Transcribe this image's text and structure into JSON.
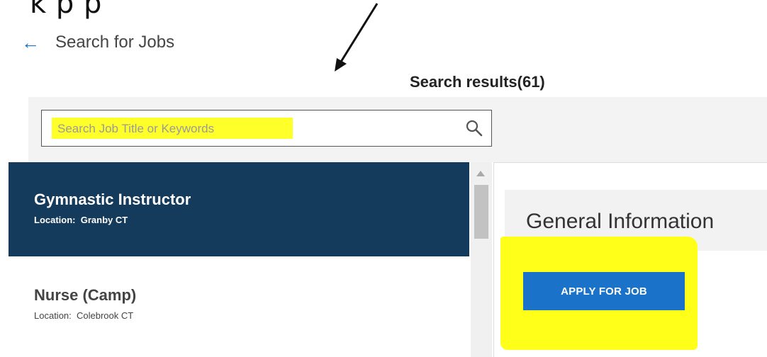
{
  "annotation": {
    "partial_text": "k   p   p"
  },
  "header": {
    "back_label": "Search for Jobs",
    "results_title": "Search results(61)"
  },
  "search": {
    "placeholder": "Search Job Title or Keywords",
    "value": ""
  },
  "jobs": [
    {
      "title": "Gymnastic Instructor",
      "location_label": "Location:",
      "location": "Granby CT",
      "selected": true
    },
    {
      "title": "Nurse (Camp)",
      "location_label": "Location:",
      "location": "Colebrook CT",
      "selected": false
    }
  ],
  "detail": {
    "section_title": "General Information",
    "apply_label": "APPLY FOR JOB"
  },
  "colors": {
    "accent": "#1a73c8",
    "selected_row": "#143a5c",
    "highlight": "#ffff1a"
  },
  "icons": [
    "arrow-left-icon",
    "search-icon",
    "scroll-up-icon"
  ]
}
